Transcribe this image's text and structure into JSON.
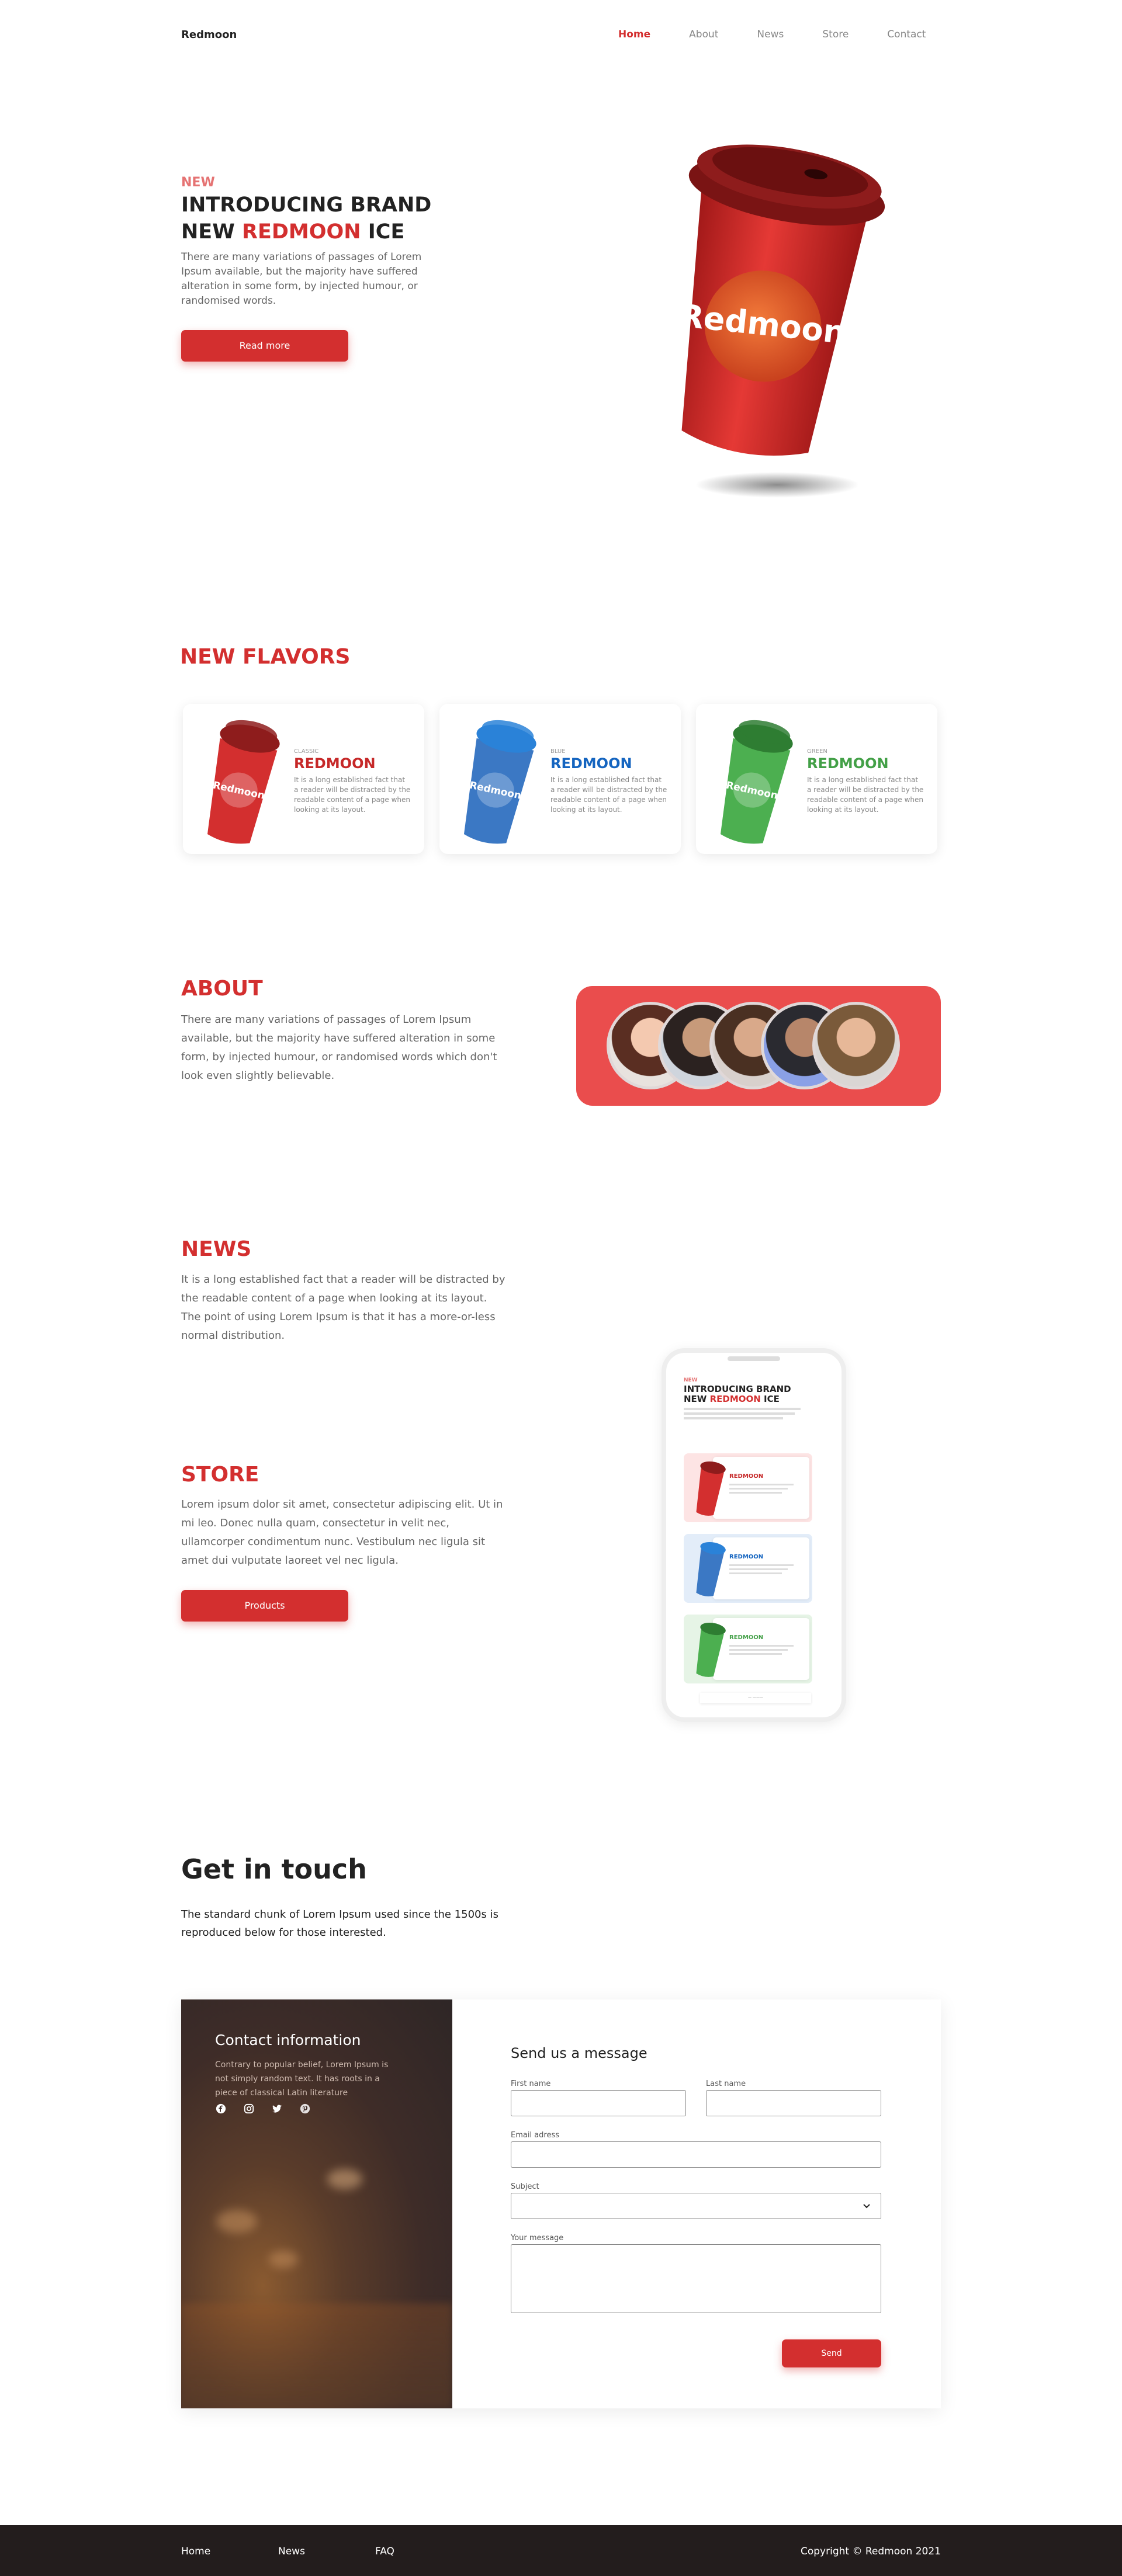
{
  "nav": {
    "logo": "Redmoon",
    "items": [
      "Home",
      "About",
      "News",
      "Store",
      "Contact"
    ]
  },
  "hero": {
    "tag": "NEW",
    "title_line1": "INTRODUCING BRAND",
    "title_new": "NEW ",
    "title_brand": "REDMOON",
    "title_end": " ICE",
    "description": "There are many variations of passages of Lorem Ipsum available, but the majority have suffered alteration in some form, by injected humour, or randomised words.",
    "button": "Read more",
    "cup_text": "Redmoon"
  },
  "flavors": {
    "title": "NEW FLAVORS",
    "cards": [
      {
        "small": "CLASSIC",
        "brand": "REDMOON",
        "text": "It is a long established fact that a reader will be distracted by the readable content of a page when looking at its layout.",
        "color": "#c62828",
        "cup": "#d32f2f",
        "lid": "#8e1c1c"
      },
      {
        "small": "BLUE",
        "brand": "REDMOON",
        "text": "It is a long established fact that a reader will be distracted by the readable content of a page when looking at its layout.",
        "color": "#1565c0",
        "cup": "#3b78c4",
        "lid": "#2a82d8"
      },
      {
        "small": "GREEN",
        "brand": "REDMOON",
        "text": "It is a long established fact that a reader will be distracted by the readable content of a page when looking at its layout.",
        "color": "#43a047",
        "cup": "#4caf50",
        "lid": "#2e7d32"
      }
    ]
  },
  "about": {
    "title": "ABOUT",
    "description": "There are many variations of passages of Lorem Ipsum available, but the majority have suffered alteration in some form, by injected humour, or randomised words which don't look even slightly believable."
  },
  "news": {
    "title": "NEWS",
    "description": "It is a long established fact that a reader will be distracted by the readable content of a page when looking at its layout. The point of using Lorem Ipsum is that it has a more-or-less normal distribution."
  },
  "store": {
    "title": "STORE",
    "description": "Lorem ipsum dolor sit amet, consectetur adipiscing elit. Ut in mi leo. Donec nulla quam, consectetur in velit nec, ullamcorper condimentum nunc. Vestibulum nec ligula sit amet dui vulputate laoreet vel nec ligula.",
    "button": "Products"
  },
  "phone_preview": {
    "tag": "NEW",
    "title_line1": "INTRODUCING BRAND",
    "title_new": "NEW ",
    "title_brand": "REDMOON",
    "title_end": " ICE"
  },
  "contact": {
    "title": "Get in touch",
    "description": "The standard chunk of Lorem Ipsum used since the 1500s is reproduced below for those interested.",
    "info_title": "Contact information",
    "info_text": "Contrary to popular belief, Lorem Ipsum is not simply random text. It has roots in a piece of classical Latin literature",
    "form_title": "Send us a message",
    "first_name": "First name",
    "last_name": "Last name",
    "email": "Email adress",
    "subject": "Subject",
    "message": "Your message",
    "send": "Send"
  },
  "footer": {
    "links": [
      "Home",
      "News",
      "FAQ"
    ],
    "copyright": "Copyright © Redmoon 2021"
  }
}
